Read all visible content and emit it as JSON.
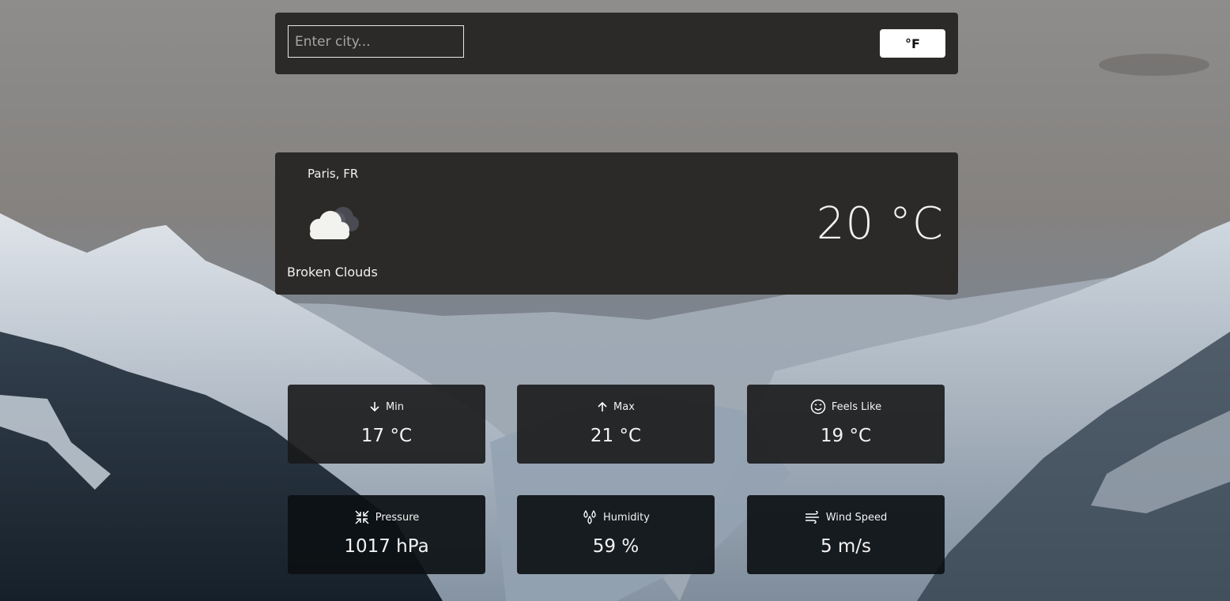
{
  "search": {
    "placeholder": "Enter city..."
  },
  "unit_toggle": {
    "label": "°F"
  },
  "current": {
    "location": "Paris, FR",
    "condition": "Broken Clouds",
    "temperature": "20 °C",
    "icon": "broken-clouds-icon"
  },
  "details": [
    {
      "label": "Min",
      "value": "17 °C",
      "icon": "arrow-down-icon"
    },
    {
      "label": "Max",
      "value": "21 °C",
      "icon": "arrow-up-icon"
    },
    {
      "label": "Feels Like",
      "value": "19 °C",
      "icon": "smiley-icon"
    },
    {
      "label": "Pressure",
      "value": "1017 hPa",
      "icon": "compress-arrows-icon"
    },
    {
      "label": "Humidity",
      "value": "59 %",
      "icon": "water-drops-icon"
    },
    {
      "label": "Wind Speed",
      "value": "5 m/s",
      "icon": "wind-icon"
    }
  ],
  "colors": {
    "panel": "#2c2a28",
    "text": "#f1f1f1",
    "button_bg": "#ffffff"
  }
}
